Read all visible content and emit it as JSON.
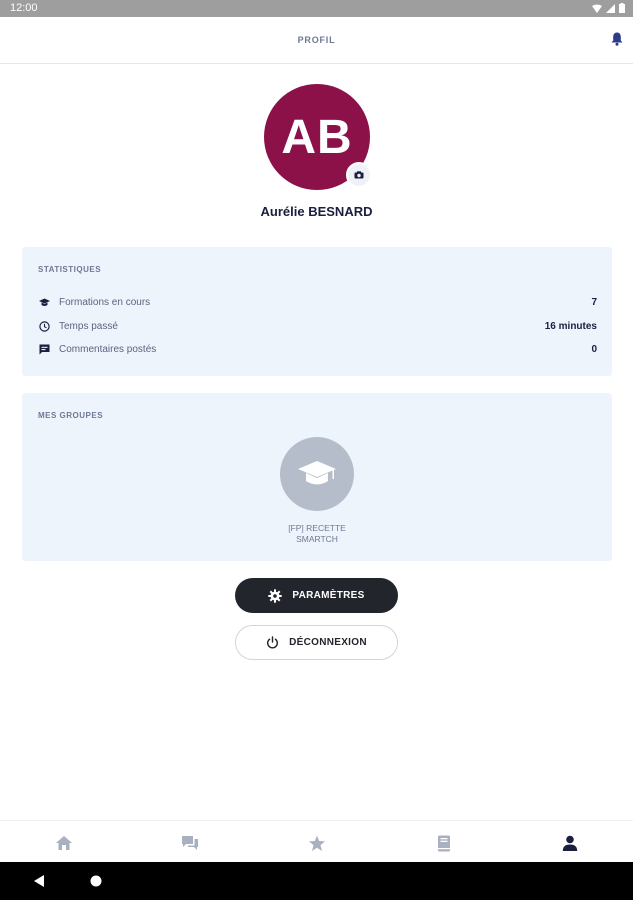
{
  "status_bar": {
    "time": "12:00",
    "icons": [
      "wifi-icon",
      "signal-icon",
      "battery-icon"
    ]
  },
  "app_bar": {
    "title": "PROFIL",
    "notification_icon": "bell-icon"
  },
  "profile": {
    "initials": "AB",
    "name": "Aurélie BESNARD",
    "avatar_color": "#8c1149",
    "camera_icon": "camera-icon"
  },
  "stats": {
    "title": "STATISTIQUES",
    "rows": [
      {
        "icon": "graduation-cap-icon",
        "label": "Formations en cours",
        "value": "7"
      },
      {
        "icon": "clock-icon",
        "label": "Temps passé",
        "value": "16 minutes"
      },
      {
        "icon": "comment-icon",
        "label": "Commentaires postés",
        "value": "0"
      }
    ]
  },
  "groups": {
    "title": "MES GROUPES",
    "items": [
      {
        "icon": "graduation-cap-icon",
        "label_line1": "[FP] RECETTE",
        "label_line2": "SMARTCH"
      }
    ]
  },
  "actions": {
    "settings_label": "PARAMÈTRES",
    "logout_label": "DÉCONNEXION"
  },
  "bottom_nav": {
    "items": [
      {
        "icon": "home-icon",
        "active": false
      },
      {
        "icon": "chat-icon",
        "active": false
      },
      {
        "icon": "star-icon",
        "active": false
      },
      {
        "icon": "book-icon",
        "active": false
      },
      {
        "icon": "person-icon",
        "active": true
      }
    ]
  },
  "colors": {
    "accent": "#8c1149",
    "dark_button": "#23252c",
    "card_bg": "#eef4fc",
    "nav_inactive": "#a9b0c0",
    "nav_active": "#1a1f3d"
  }
}
